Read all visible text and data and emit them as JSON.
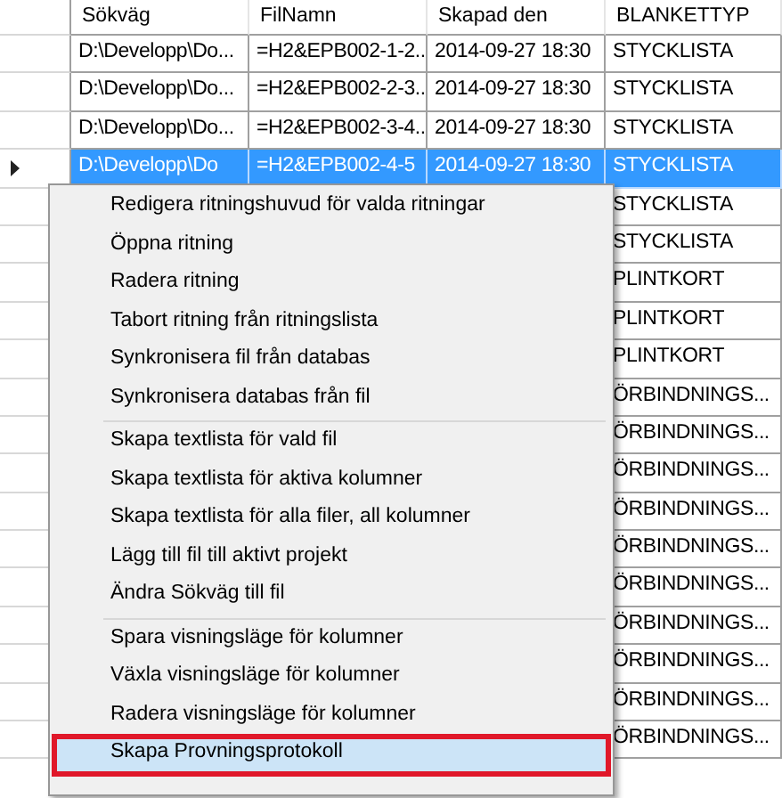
{
  "grid": {
    "columns": [
      "Sökväg",
      "FilNamn",
      "Skapad den",
      "BLANKETTYP"
    ],
    "rows": [
      {
        "cells": [
          "D:\\Developp\\Do...",
          "=H2&EPB002-1-2...",
          "2014-09-27 18:30",
          "STYCKLISTA"
        ],
        "selected": false
      },
      {
        "cells": [
          "D:\\Developp\\Do...",
          "=H2&EPB002-2-3...",
          "2014-09-27 18:30",
          "STYCKLISTA"
        ],
        "selected": false
      },
      {
        "cells": [
          "D:\\Developp\\Do...",
          "=H2&EPB002-3-4...",
          "2014-09-27 18:30",
          "STYCKLISTA"
        ],
        "selected": false
      },
      {
        "cells": [
          "D:\\Developp\\Do",
          "=H2&EPB002-4-5",
          "2014-09-27 18:30",
          "STYCKLISTA"
        ],
        "selected": true
      },
      {
        "cells": [
          "STYCKLISTA"
        ],
        "selected": false
      },
      {
        "cells": [
          "STYCKLISTA"
        ],
        "selected": false
      },
      {
        "cells": [
          "PLINTKORT"
        ],
        "selected": false
      },
      {
        "cells": [
          "PLINTKORT"
        ],
        "selected": false
      },
      {
        "cells": [
          "PLINTKORT"
        ],
        "selected": false
      },
      {
        "cells": [
          "ÖRBINDNINGS..."
        ],
        "selected": false
      },
      {
        "cells": [
          "ÖRBINDNINGS..."
        ],
        "selected": false
      },
      {
        "cells": [
          "ÖRBINDNINGS..."
        ],
        "selected": false
      },
      {
        "cells": [
          "ÖRBINDNINGS..."
        ],
        "selected": false
      },
      {
        "cells": [
          "ÖRBINDNINGS..."
        ],
        "selected": false
      },
      {
        "cells": [
          "ÖRBINDNINGS..."
        ],
        "selected": false
      },
      {
        "cells": [
          "ÖRBINDNINGS..."
        ],
        "selected": false
      },
      {
        "cells": [
          "ÖRBINDNINGS..."
        ],
        "selected": false
      },
      {
        "cells": [
          "ÖRBINDNINGS..."
        ],
        "selected": false
      },
      {
        "cells": [
          "ÖRBINDNINGS..."
        ],
        "selected": false
      }
    ]
  },
  "context_menu": {
    "groups": [
      [
        {
          "label": "Redigera ritningshuvud för valda ritningar",
          "selected": false
        },
        {
          "label": "Öppna ritning",
          "selected": false
        },
        {
          "label": "Radera ritning",
          "selected": false
        },
        {
          "label": "Tabort ritning från ritningslista",
          "selected": false
        },
        {
          "label": "Synkronisera fil från databas",
          "selected": false
        },
        {
          "label": "Synkronisera databas från fil",
          "selected": false
        }
      ],
      [
        {
          "label": "Skapa textlista för vald fil",
          "selected": false
        },
        {
          "label": "Skapa textlista för aktiva kolumner",
          "selected": false
        },
        {
          "label": "Skapa textlista för alla filer, all kolumner",
          "selected": false
        },
        {
          "label": "Lägg till fil till aktivt projekt",
          "selected": false
        },
        {
          "label": "Ändra Sökväg till fil",
          "selected": false
        }
      ],
      [
        {
          "label": "Spara visningsläge för kolumner",
          "selected": false
        },
        {
          "label": "Växla visningsläge för kolumner",
          "selected": false
        },
        {
          "label": "Radera visningsläge för kolumner",
          "selected": false
        },
        {
          "label": "Skapa Provningsprotokoll",
          "selected": true
        }
      ]
    ]
  }
}
